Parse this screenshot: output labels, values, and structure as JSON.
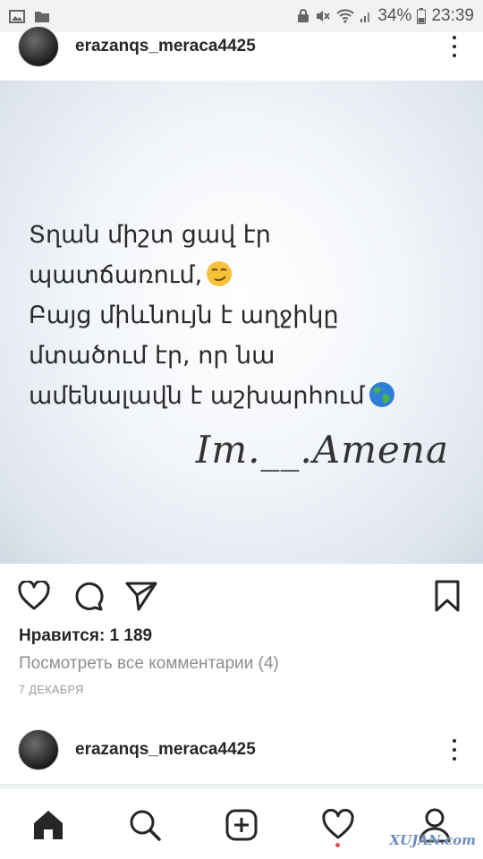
{
  "status_bar": {
    "battery": "34%",
    "time": "23:39",
    "icons": [
      "image-icon",
      "folder-icon",
      "lock-icon",
      "mute-icon",
      "wifi-icon",
      "signal-icon",
      "battery-icon"
    ]
  },
  "post": {
    "username": "erazanqs_meraca4425",
    "quote_lines": [
      "Տղան միշտ ցավ էր",
      "պատճառում,",
      "Բայց միևնույն է աղջիկը",
      "մտածում էր, որ նա",
      "ամենալավն է աշխարհում"
    ],
    "signature": "Im.__.Amena",
    "likes": "Нравится: 1 189",
    "view_comments": "Посмотреть все комментарии (4)",
    "date": "7 ДЕКАБРЯ"
  },
  "next_post": {
    "username": "erazanqs_meraca4425"
  },
  "nav": {
    "items": [
      "home-icon",
      "search-icon",
      "add-post-icon",
      "activity-heart-icon",
      "profile-icon"
    ]
  },
  "watermark": "XUJAN.com",
  "colors": {
    "text": "#262626",
    "muted": "#8e8e8e",
    "notification": "#ed4956"
  }
}
